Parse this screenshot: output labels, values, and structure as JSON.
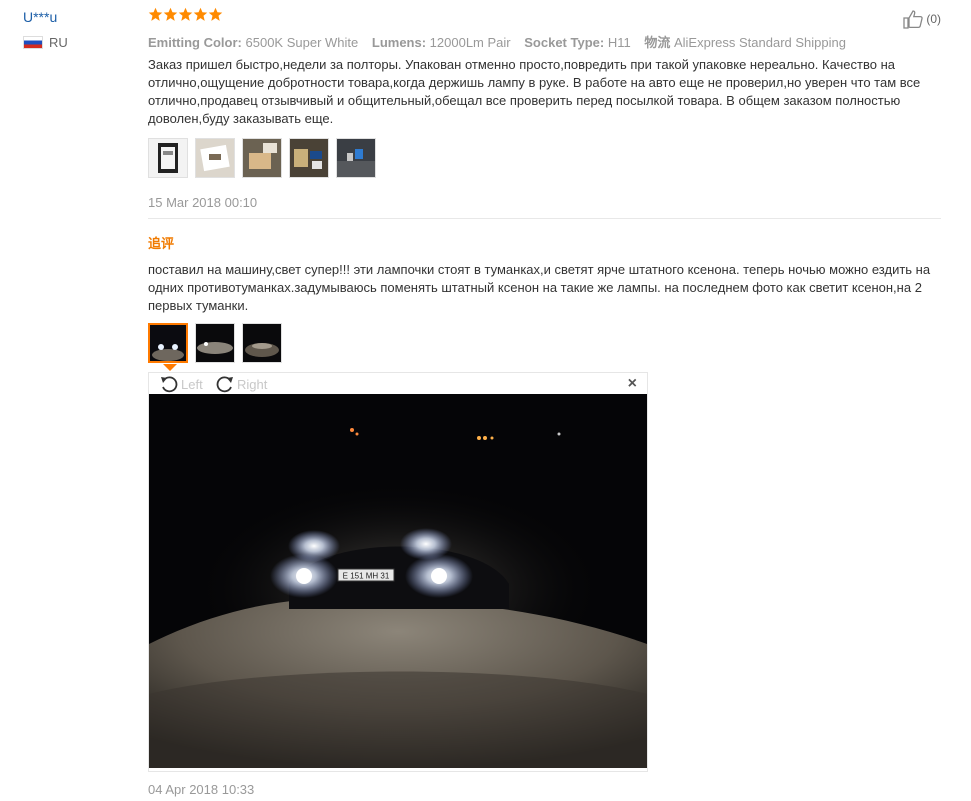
{
  "review": {
    "user": "U***u",
    "country": "RU",
    "like_count": "(0)",
    "rating": 5,
    "attributes": [
      {
        "key": "Emitting Color:",
        "value": "6500K Super White"
      },
      {
        "key": "Lumens:",
        "value": "12000Lm Pair"
      },
      {
        "key": "Socket Type:",
        "value": "H11"
      },
      {
        "key": "物流",
        "value": "AliExpress Standard Shipping"
      }
    ],
    "text": "Заказ пришел быстро,недели за полторы. Упакован отменно просто,повредить при такой упаковке нереально. Качество на отлично,ощущение добротности товара,когда держишь лампу в руке. В работе на авто еще не проверил,но уверен что там все отлично,продавец отзывчивый и общительный,обещал все проверить перед посылкой товара. В общем заказом полностью доволен,буду заказывать еще.",
    "date": "15 Mar 2018 00:10"
  },
  "followup": {
    "label": "追评",
    "text": "поставил на машину,свет супер!!! эти лампочки стоят в туманках,и светят ярче штатного ксенона. теперь ночью можно ездить на одних противотуманках.задумываюсь поменять штатный ксенон на такие же лампы. на последнем фото как светит ксенон,на 2 первых туманки.",
    "date": "04 Apr 2018 10:33"
  },
  "viewer": {
    "rotate_left": "Left",
    "rotate_right": "Right",
    "close": "×",
    "plate_text": "Е 151 МН 31"
  },
  "icons": {
    "star": "star-icon",
    "like": "thumbs-up-icon",
    "rotate_left": "rotate-left-icon",
    "rotate_right": "rotate-right-icon",
    "close": "close-icon"
  },
  "colors": {
    "star": "#ff8a00",
    "link": "#1d5fa8",
    "followup": "#f07a00",
    "active_border": "#ff7a00"
  }
}
